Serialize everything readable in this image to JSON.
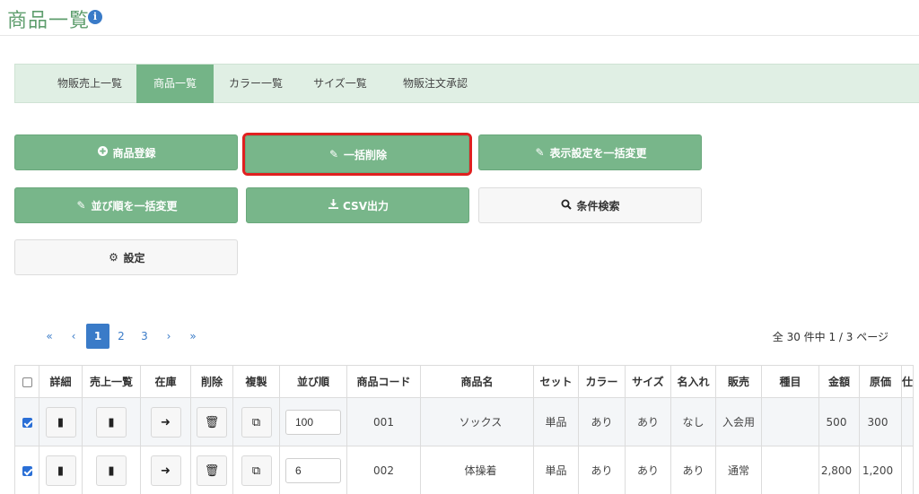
{
  "page": {
    "title": "商品一覧",
    "info_icon": "info-icon"
  },
  "tabs": [
    {
      "label": "物販売上一覧",
      "active": false
    },
    {
      "label": "商品一覧",
      "active": true
    },
    {
      "label": "カラー一覧",
      "active": false
    },
    {
      "label": "サイズ一覧",
      "active": false
    },
    {
      "label": "物販注文承認",
      "active": false
    }
  ],
  "actions": {
    "register": {
      "label": "商品登録",
      "icon": "plus-circle-icon"
    },
    "bulk_delete": {
      "label": "一括削除",
      "icon": "pencil-icon"
    },
    "bulk_display": {
      "label": "表示設定を一括変更",
      "icon": "pencil-icon"
    },
    "bulk_order": {
      "label": "並び順を一括変更",
      "icon": "pencil-icon"
    },
    "csv": {
      "label": "CSV出力",
      "icon": "download-icon"
    },
    "search": {
      "label": "条件検索",
      "icon": "search-icon"
    },
    "settings": {
      "label": "設定",
      "icon": "gear-icon"
    }
  },
  "pagination": {
    "first": "«",
    "prev": "‹",
    "pages": [
      "1",
      "2",
      "3"
    ],
    "current": "1",
    "next": "›",
    "last": "»",
    "summary": "全 30 件中 1 / 3 ページ"
  },
  "table": {
    "headers": [
      "詳細",
      "売上一覧",
      "在庫",
      "削除",
      "複製",
      "並び順",
      "商品コード",
      "商品名",
      "セット",
      "カラー",
      "サイズ",
      "名入れ",
      "販売",
      "種目",
      "金額",
      "原価",
      "仕"
    ],
    "rows": [
      {
        "checked": true,
        "order": "100",
        "code": "001",
        "name": "ソックス",
        "set": "単品",
        "color": "あり",
        "size": "あり",
        "naire": "なし",
        "sale": "入会用",
        "event": "",
        "price": "500",
        "cost": "300"
      },
      {
        "checked": true,
        "order": "6",
        "code": "002",
        "name": "体操着",
        "set": "単品",
        "color": "あり",
        "size": "あり",
        "naire": "あり",
        "sale": "通常",
        "event": "",
        "price": "2,800",
        "cost": "1,200"
      }
    ]
  },
  "colors": {
    "accent_green": "#78b68a",
    "tab_bg": "#e0efe4",
    "link_blue": "#3a7bc8",
    "highlight_red": "#e02020"
  }
}
